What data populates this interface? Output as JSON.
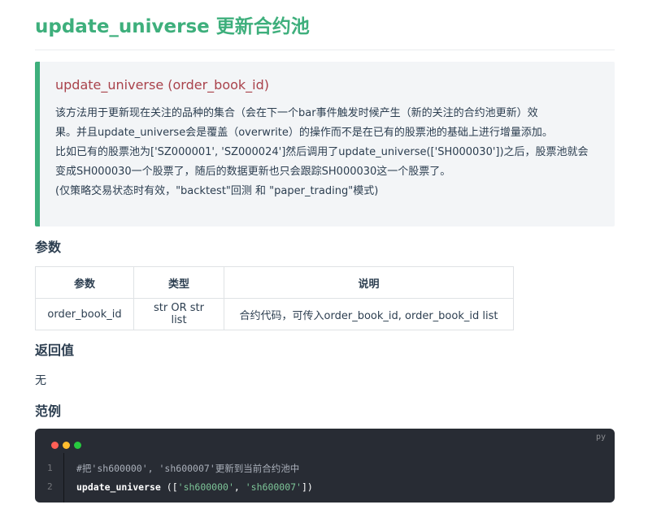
{
  "heading": "update_universe 更新合约池",
  "tip": {
    "title": "update_universe (order_book_id)",
    "lines": [
      "该方法用于更新现在关注的品种的集合（会在下一个bar事件触发时候产生（新的关注的合约池更新）效",
      "果。并且update_universe会是覆盖（overwrite）的操作而不是在已有的股票池的基础上进行增量添加。",
      "比如已有的股票池为['SZ000001', 'SZ000024']然后调用了update_universe(['SH000030'])之后，股票池就会",
      "变成SH000030一个股票了，随后的数据更新也只会跟踪SH000030这一个股票了。",
      "(仅策略交易状态时有效，\"backtest\"回测 和 \"paper_trading\"模式)"
    ]
  },
  "params_heading": "参数",
  "params_table": {
    "headers": [
      "参数",
      "类型",
      "说明"
    ],
    "rows": [
      [
        "order_book_id",
        "str OR str list",
        "合约代码，可传入order_book_id, order_book_id list"
      ]
    ]
  },
  "return_heading": "返回值",
  "return_value": "无",
  "example_heading": "范例",
  "code": {
    "lang": "py",
    "line_numbers": [
      "1",
      "2"
    ],
    "comment": "#把'sh600000', 'sh600007'更新到当前合约池中",
    "fn": "update_universe",
    "open": " ([",
    "str1": "'sh600000'",
    "sep": ", ",
    "str2": "'sh600007'",
    "close": "])",
    "dot_colors": [
      "#ff5f56",
      "#ffbd2e",
      "#27c93f"
    ]
  }
}
